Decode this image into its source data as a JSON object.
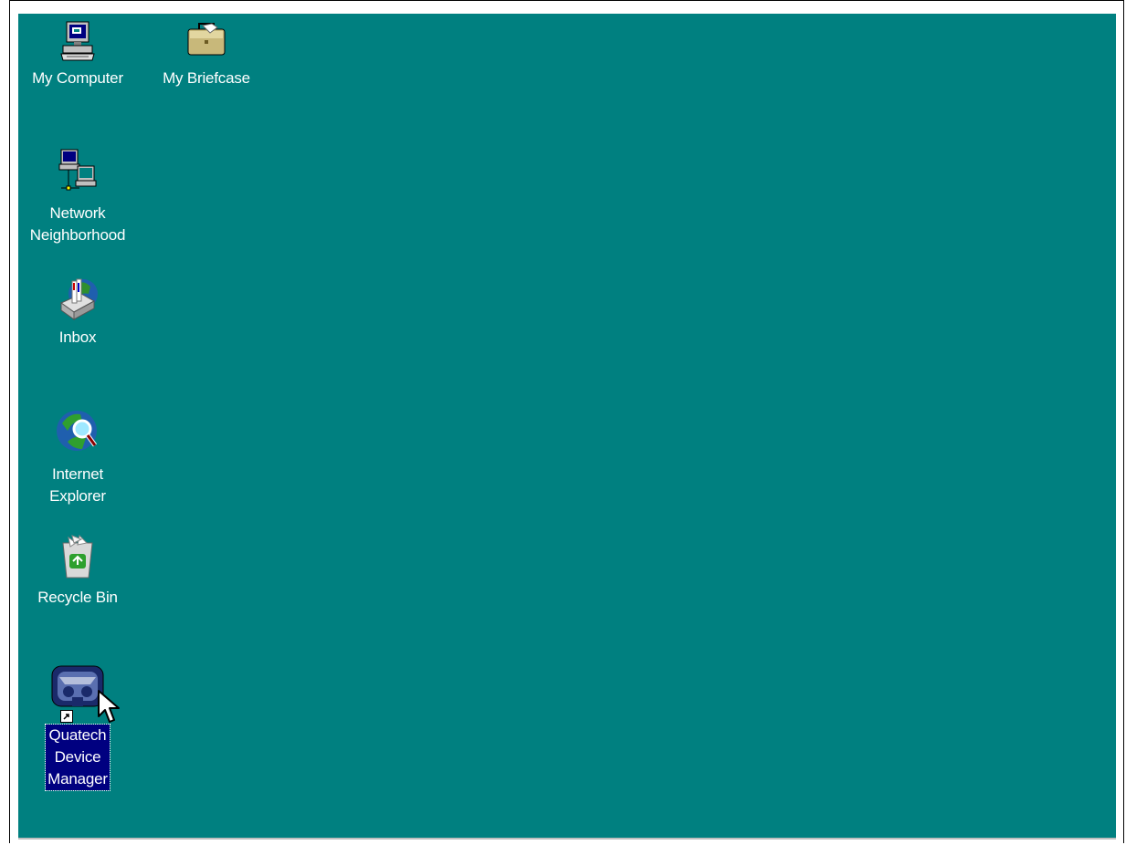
{
  "desktop": {
    "background": "#008080",
    "icons": [
      {
        "label": "My Computer",
        "icon": "computer-icon"
      },
      {
        "label": "My Briefcase",
        "icon": "briefcase-icon"
      },
      {
        "label": "Network\nNeighborhood",
        "icon": "network-icon"
      },
      {
        "label": "Inbox",
        "icon": "inbox-icon"
      },
      {
        "label": "Internet\nExplorer",
        "icon": "internet-explorer-icon"
      },
      {
        "label": "Recycle Bin",
        "icon": "recycle-bin-icon"
      },
      {
        "label": "Quatech\nDevice\nManager",
        "icon": "quatech-device-manager-icon",
        "selected": true,
        "shortcut": true
      }
    ]
  }
}
